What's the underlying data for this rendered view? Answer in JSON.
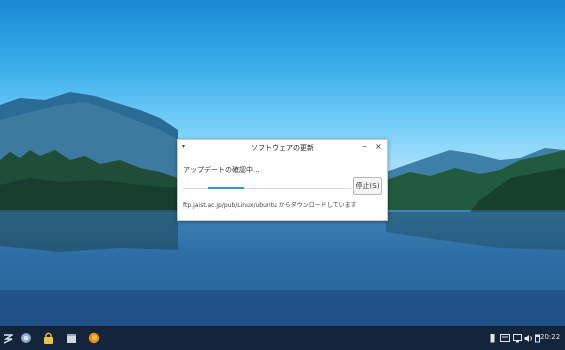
{
  "dialog": {
    "title": "ソフトウェアの更新",
    "menu_glyph": "▾",
    "minimize_glyph": "‒",
    "close_glyph": "×",
    "status": "アップデートの確認中...",
    "stop_button": "停止(S)",
    "download_text": "ftp.jaist.ac.jp/pub/Linux/ubuntu からダウンロードしています"
  },
  "taskbar": {
    "icons": [
      "app-menu-icon",
      "browser-icon",
      "lock-icon",
      "files-icon",
      "firefox-icon"
    ],
    "tray_icons": [
      "battery-icon",
      "keyboard-icon",
      "display-icon",
      "volume-icon",
      "calendar-icon"
    ],
    "clock": "20:22"
  },
  "colors": {
    "taskbar": "#14243a",
    "progress_accent": "#2e9ad8"
  }
}
